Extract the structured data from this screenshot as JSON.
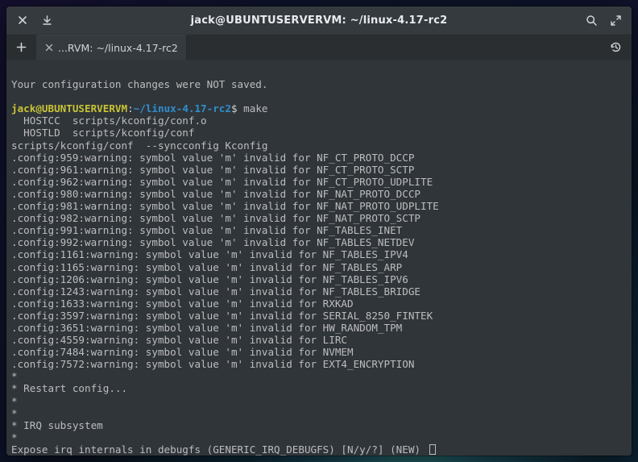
{
  "titlebar": {
    "title": "jack@UBUNTUSERVERVM: ~/linux-4.17-rc2"
  },
  "tab": {
    "label": "...RVM: ~/linux-4.17-rc2"
  },
  "prompt": {
    "user_host": "jack@UBUNTUSERVERVM",
    "path": "~/linux-4.17-rc2",
    "command": "make"
  },
  "lines": {
    "not_saved": "Your configuration changes were NOT saved.",
    "hostcc": "  HOSTCC  scripts/kconfig/conf.o",
    "hostld": "  HOSTLD  scripts/kconfig/conf",
    "sync": "scripts/kconfig/conf  --syncconfig Kconfig",
    "w959": ".config:959:warning: symbol value 'm' invalid for NF_CT_PROTO_DCCP",
    "w961": ".config:961:warning: symbol value 'm' invalid for NF_CT_PROTO_SCTP",
    "w962": ".config:962:warning: symbol value 'm' invalid for NF_CT_PROTO_UDPLITE",
    "w980": ".config:980:warning: symbol value 'm' invalid for NF_NAT_PROTO_DCCP",
    "w981": ".config:981:warning: symbol value 'm' invalid for NF_NAT_PROTO_UDPLITE",
    "w982": ".config:982:warning: symbol value 'm' invalid for NF_NAT_PROTO_SCTP",
    "w991": ".config:991:warning: symbol value 'm' invalid for NF_TABLES_INET",
    "w992": ".config:992:warning: symbol value 'm' invalid for NF_TABLES_NETDEV",
    "w1161": ".config:1161:warning: symbol value 'm' invalid for NF_TABLES_IPV4",
    "w1165": ".config:1165:warning: symbol value 'm' invalid for NF_TABLES_ARP",
    "w1206": ".config:1206:warning: symbol value 'm' invalid for NF_TABLES_IPV6",
    "w1243": ".config:1243:warning: symbol value 'm' invalid for NF_TABLES_BRIDGE",
    "w1633": ".config:1633:warning: symbol value 'm' invalid for RXKAD",
    "w3597": ".config:3597:warning: symbol value 'm' invalid for SERIAL_8250_FINTEK",
    "w3651": ".config:3651:warning: symbol value 'm' invalid for HW_RANDOM_TPM",
    "w4559": ".config:4559:warning: symbol value 'm' invalid for LIRC",
    "w7484": ".config:7484:warning: symbol value 'm' invalid for NVMEM",
    "w7572": ".config:7572:warning: symbol value 'm' invalid for EXT4_ENCRYPTION",
    "star1": "*",
    "restart": "* Restart config...",
    "star2": "*",
    "star3": "*",
    "irq": "* IRQ subsystem",
    "star4": "*",
    "expose": "Expose irq internals in debugfs (GENERIC_IRQ_DEBUGFS) [N/y/?] (NEW) "
  }
}
